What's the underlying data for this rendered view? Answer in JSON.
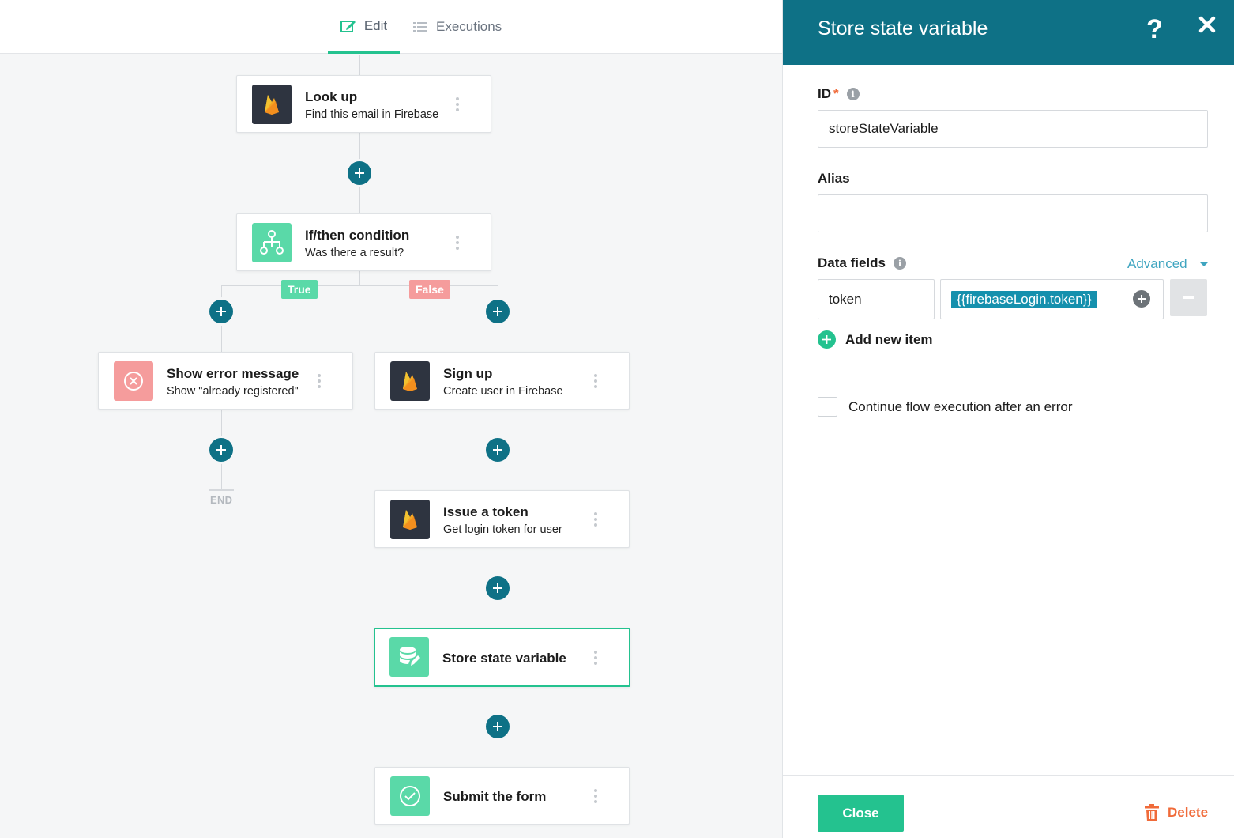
{
  "tabs": {
    "edit": "Edit",
    "executions": "Executions"
  },
  "flow": {
    "branch_true": "True",
    "branch_false": "False",
    "end_label": "END",
    "nodes": {
      "lookup": {
        "title": "Look up",
        "subtitle": "Find this email in Firebase",
        "icon": "firebase-icon"
      },
      "condition": {
        "title": "If/then condition",
        "subtitle": "Was there a result?",
        "icon": "branch-icon"
      },
      "error": {
        "title": "Show error message",
        "subtitle": "Show \"already registered\"",
        "icon": "error-icon"
      },
      "signup": {
        "title": "Sign up",
        "subtitle": "Create user in Firebase",
        "icon": "firebase-icon"
      },
      "token": {
        "title": "Issue a token",
        "subtitle": "Get login token for user",
        "icon": "firebase-icon"
      },
      "store": {
        "title": "Store state variable",
        "icon": "database-edit-icon"
      },
      "submit": {
        "title": "Submit the form",
        "icon": "check-circle-icon"
      }
    }
  },
  "panel": {
    "title": "Store state variable",
    "help": "?",
    "id_label": "ID",
    "id_required_mark": "*",
    "id_value": "storeStateVariable",
    "alias_label": "Alias",
    "alias_value": "",
    "data_fields_label": "Data fields",
    "advanced_label": "Advanced",
    "field_key": "token",
    "field_value": "{{firebaseLogin.token}}",
    "add_item_label": "Add new item",
    "continue_label": "Continue flow execution after an error",
    "continue_checked": false,
    "close_label": "Close",
    "delete_label": "Delete"
  },
  "colors": {
    "header_teal": "#0e7186",
    "accent_green": "#24c28f",
    "delete_orange": "#f06b3a",
    "true_green": "#5ad9a8",
    "false_red": "#f59c9c"
  }
}
